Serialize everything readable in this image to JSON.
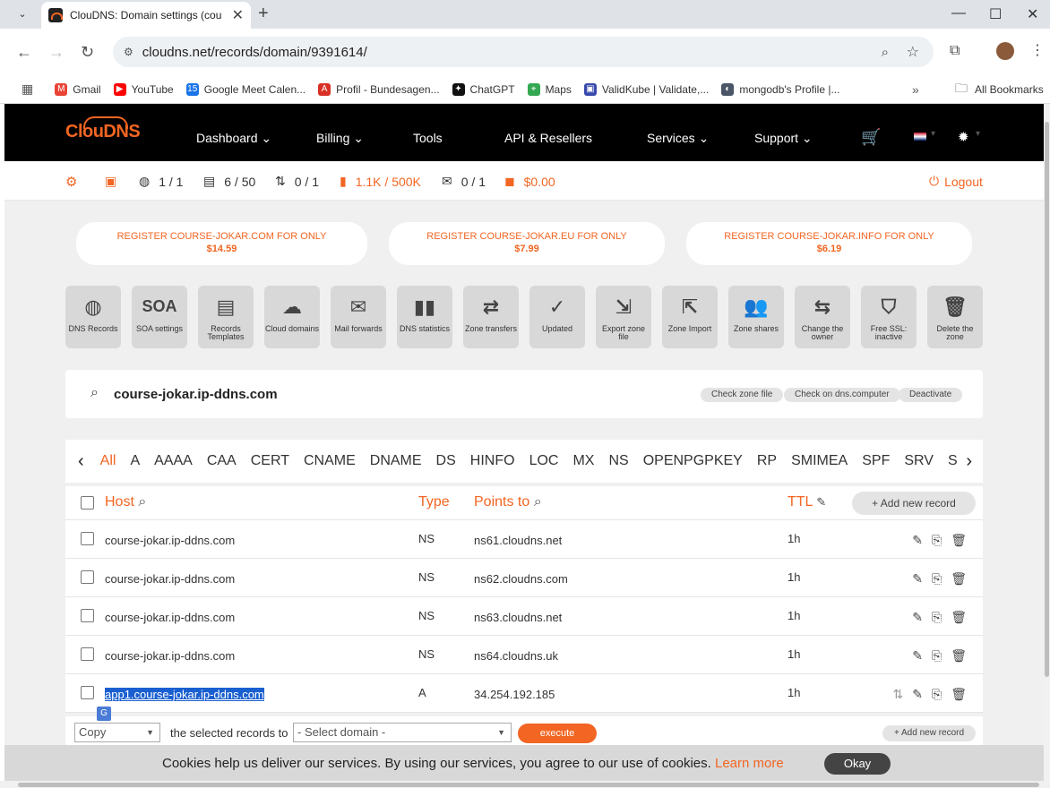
{
  "browser": {
    "tab_title": "ClouDNS: Domain settings (cou",
    "url": "cloudns.net/records/domain/9391614/",
    "bookmarks": [
      {
        "label": "Gmail",
        "color": "#ea4335",
        "glyph": "M"
      },
      {
        "label": "YouTube",
        "color": "#ff0000",
        "glyph": "▶"
      },
      {
        "label": "Google Meet Calen...",
        "color": "#1a73e8",
        "glyph": "15"
      },
      {
        "label": "Profil - Bundesagen...",
        "color": "#d93025",
        "glyph": "A"
      },
      {
        "label": "ChatGPT",
        "color": "#111111",
        "glyph": "✦"
      },
      {
        "label": "Maps",
        "color": "#34a853",
        "glyph": "⌖"
      },
      {
        "label": "ValidKube | Validate,...",
        "color": "#3949ab",
        "glyph": "▣"
      },
      {
        "label": "mongodb's Profile |...",
        "color": "#4a5568",
        "glyph": "◐"
      }
    ],
    "all_bookmarks": "All Bookmarks"
  },
  "site": {
    "logo": "ClouDNS",
    "nav": [
      "Dashboard",
      "Billing",
      "Tools",
      "API & Resellers",
      "Services",
      "Support"
    ],
    "stats": {
      "zones": "1 / 1",
      "records": "6 / 50",
      "transfers": "0 / 1",
      "queries": "1.1K / 500K",
      "mail": "0 / 1",
      "balance": "$0.00"
    },
    "logout": "Logout",
    "promos": [
      {
        "line1": "REGISTER COURSE-JOKAR.COM FOR ONLY",
        "line2": "$14.59"
      },
      {
        "line1": "REGISTER COURSE-JOKAR.EU FOR ONLY",
        "line2": "$7.99"
      },
      {
        "line1": "REGISTER COURSE-JOKAR.INFO FOR ONLY",
        "line2": "$6.19"
      }
    ],
    "tools": [
      {
        "label": "DNS Records",
        "icon": "globe-icon"
      },
      {
        "label": "SOA settings",
        "icon": "soa-icon"
      },
      {
        "label": "Records Templates",
        "icon": "template-icon"
      },
      {
        "label": "Cloud domains",
        "icon": "cloud-icon"
      },
      {
        "label": "Mail forwards",
        "icon": "mail-icon"
      },
      {
        "label": "DNS statistics",
        "icon": "bar-chart-icon"
      },
      {
        "label": "Zone transfers",
        "icon": "transfer-icon"
      },
      {
        "label": "Updated",
        "icon": "check-icon"
      },
      {
        "label": "Export zone file",
        "icon": "export-icon"
      },
      {
        "label": "Zone Import",
        "icon": "import-icon"
      },
      {
        "label": "Zone shares",
        "icon": "users-icon"
      },
      {
        "label": "Change the owner",
        "icon": "owner-icon"
      },
      {
        "label": "Free SSL: inactive",
        "icon": "ssl-icon"
      },
      {
        "label": "Delete the zone",
        "icon": "trash-icon"
      }
    ],
    "domain": "course-jokar.ip-ddns.com",
    "domain_actions": [
      "Check zone file",
      "Check on dns.computer",
      "Deactivate"
    ],
    "filters": [
      "All",
      "A",
      "AAAA",
      "CAA",
      "CERT",
      "CNAME",
      "DNAME",
      "DS",
      "HINFO",
      "LOC",
      "MX",
      "NS",
      "OPENPGPKEY",
      "RP",
      "SMIMEA",
      "SPF",
      "SRV",
      "S"
    ],
    "table": {
      "headers": {
        "host": "Host",
        "type": "Type",
        "points": "Points to",
        "ttl": "TTL"
      },
      "add_record": "+ Add new record",
      "rows": [
        {
          "host": "course-jokar.ip-ddns.com",
          "type": "NS",
          "points": "ns61.cloudns.net",
          "ttl": "1h"
        },
        {
          "host": "course-jokar.ip-ddns.com",
          "type": "NS",
          "points": "ns62.cloudns.com",
          "ttl": "1h"
        },
        {
          "host": "course-jokar.ip-ddns.com",
          "type": "NS",
          "points": "ns63.cloudns.net",
          "ttl": "1h"
        },
        {
          "host": "course-jokar.ip-ddns.com",
          "type": "NS",
          "points": "ns64.cloudns.uk",
          "ttl": "1h"
        },
        {
          "host": "app1.course-jokar.ip-ddns.com",
          "type": "A",
          "points": "34.254.192.185",
          "ttl": "1h"
        }
      ]
    },
    "bulk": {
      "action": "Copy",
      "text": "the selected records to",
      "domain_select": "- Select domain -",
      "execute": "execute",
      "add_record": "+ Add new record"
    },
    "cookie": {
      "text": "Cookies help us deliver our services. By using our services, you agree to our use of cookies.",
      "link": "Learn more",
      "button": "Okay"
    }
  }
}
